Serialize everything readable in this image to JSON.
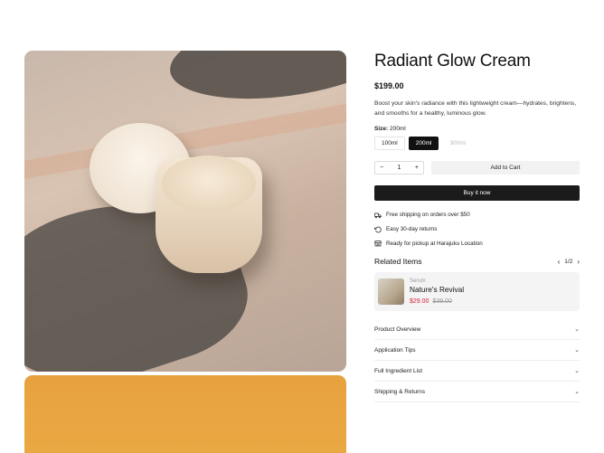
{
  "product": {
    "title": "Radiant Glow Cream",
    "price": "$199.00",
    "description": "Boost your skin's radiance with this lightweight cream—hydrates, brightens, and smooths for a healthy, luminous glow.",
    "size_label": "Size:",
    "size_selected": "200ml",
    "sizes": [
      {
        "label": "100ml",
        "state": "default"
      },
      {
        "label": "200ml",
        "state": "active"
      },
      {
        "label": "300ml",
        "state": "disabled"
      }
    ],
    "quantity": "1",
    "add_to_cart": "Add to Cart",
    "buy_now": "Buy it now"
  },
  "perks": [
    {
      "icon": "truck-icon",
      "text": "Free shipping on orders over $50"
    },
    {
      "icon": "return-icon",
      "text": "Easy 30-day returns"
    },
    {
      "icon": "store-icon",
      "text": "Ready for pickup at Harajuku Location"
    }
  ],
  "related": {
    "title": "Related Items",
    "pager": "1/2",
    "item": {
      "category": "Serum",
      "name": "Nature's Revival",
      "sale_price": "$29.00",
      "original_price": "$39.00"
    }
  },
  "accordion": [
    {
      "label": "Product Overview"
    },
    {
      "label": "Application Tips"
    },
    {
      "label": "Full Ingredient List"
    },
    {
      "label": "Shipping & Returns"
    }
  ],
  "colors": {
    "accent_dark": "#111111",
    "sale_red": "#d6203a",
    "secondary_image_bg": "#e7a23f"
  }
}
